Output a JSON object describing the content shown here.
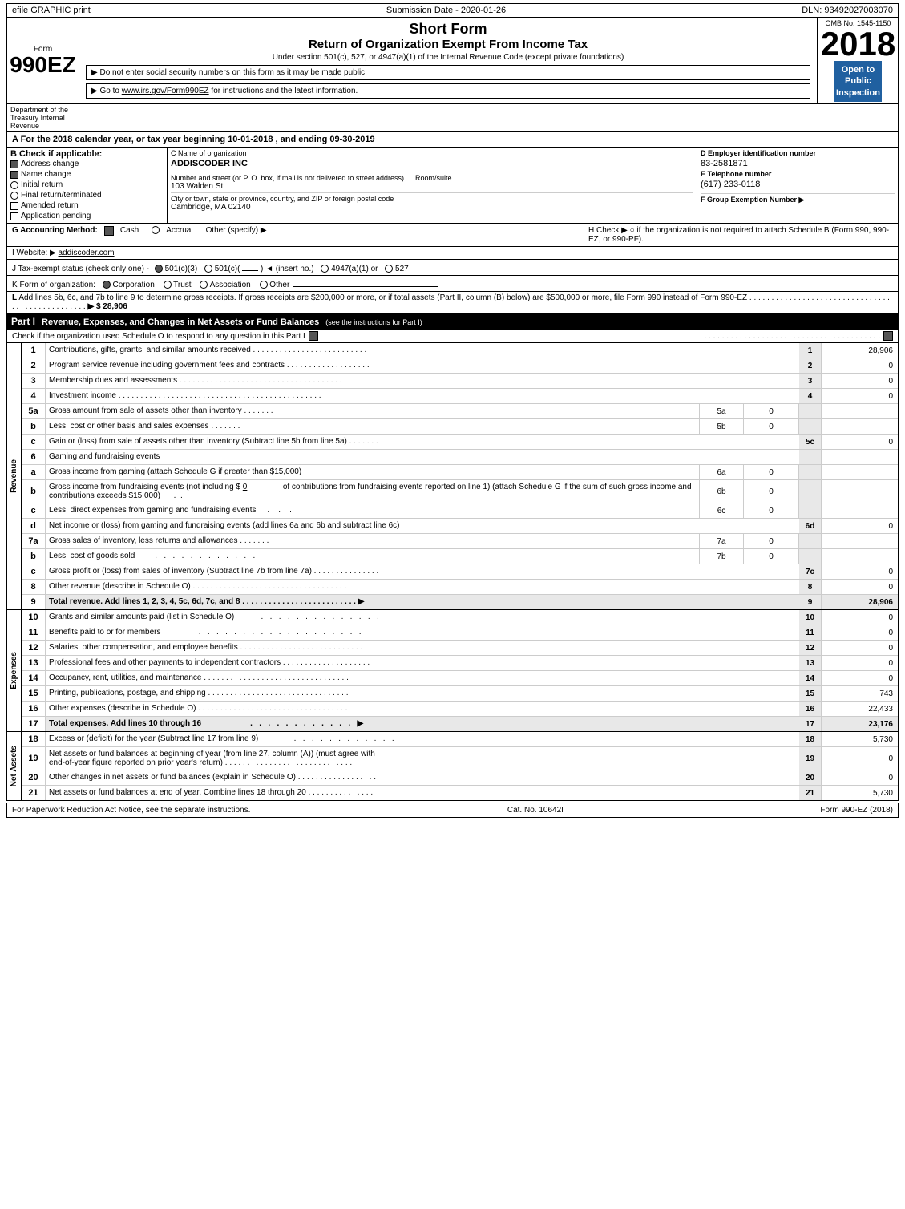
{
  "topbar": {
    "efile": "efile GRAPHIC print",
    "submission": "Submission Date - 2020-01-26",
    "dln": "DLN: 93492027003070"
  },
  "header": {
    "form_label": "Form",
    "form_number": "990EZ",
    "short_form": "Short Form",
    "return_title": "Return of Organization Exempt From Income Tax",
    "under_section": "Under section 501(c), 527, or 4947(a)(1) of the Internal Revenue Code (except private foundations)",
    "notice1": "▶ Do not enter social security numbers on this form as it may be made public.",
    "notice2": "▶ Go to www.irs.gov/Form990EZ for instructions and the latest information.",
    "omb_no": "OMB No. 1545-1150",
    "year": "2018",
    "open_to_public": "Open to\nPublic\nInspection"
  },
  "dept": {
    "name": "Department of the Treasury Internal Revenue"
  },
  "section_a": {
    "text": "A For the 2018 calendar year, or tax year beginning 10-01-2018         , and ending 09-30-2019"
  },
  "section_b": {
    "label": "B  Check if applicable:",
    "address_change": "Address change",
    "name_change": "Name change",
    "initial_return": "Initial return",
    "final_return": "Final return/terminated",
    "amended_return": "Amended return",
    "application_pending": "Application pending"
  },
  "org": {
    "c_label": "C Name of organization",
    "name": "ADDISCODER INC",
    "address_label": "Number and street (or P. O. box, if mail is not delivered to street address)",
    "address": "103 Walden St",
    "room_label": "Room/suite",
    "city_label": "City or town, state or province, country, and ZIP or foreign postal code",
    "city": "Cambridge, MA  02140",
    "d_label": "D Employer identification number",
    "ein": "83-2581871",
    "e_label": "E Telephone number",
    "phone": "(617) 233-0118",
    "f_label": "F Group Exemption Number",
    "f_arrow": "▶"
  },
  "accounting": {
    "g_label": "G Accounting Method:",
    "cash_checked": true,
    "cash_label": "Cash",
    "accrual_label": "Accrual",
    "other_label": "Other (specify) ▶",
    "h_label": "H  Check ▶",
    "h_text": "○ if the organization is not required to attach Schedule B (Form 990, 990-EZ, or 990-PF)."
  },
  "website": {
    "i_label": "I Website: ▶",
    "url": "addiscoder.com"
  },
  "tax_exempt": {
    "j_label": "J Tax-exempt status",
    "j_note": "(check only one) -",
    "status_501c3": "501(c)(3)",
    "status_501c": "501(c)(",
    "insert_no": ") ◄ (insert no.)",
    "status_4947": "4947(a)(1) or",
    "status_527": "527"
  },
  "form_org": {
    "k_label": "K Form of organization:",
    "corp": "Corporation",
    "trust": "Trust",
    "assoc": "Association",
    "other": "Other"
  },
  "l_line": {
    "text": "L Add lines 5b, 6c, and 7b to line 9 to determine gross receipts. If gross receipts are $200,000 or more, or if total assets (Part II, column (B) below) are $500,000 or more, file Form 990 instead of Form 990-EZ",
    "dots": ". . . . . . . . . . . . . . . . . . . . . . . . . . . . . . . . . . . . . . . . . . . . .",
    "amount": "▶ $ 28,906"
  },
  "part1": {
    "label": "Part I",
    "title": "Revenue, Expenses, and Changes in Net Assets or Fund Balances",
    "see_instructions": "(see the instructions for Part I)",
    "schedule_o_text": "Check if the organization used Schedule O to respond to any question in this Part I",
    "rows": [
      {
        "num": "1",
        "desc": "Contributions, gifts, grants, and similar amounts received",
        "dots": true,
        "linenum": "1",
        "amount": "28,906"
      },
      {
        "num": "2",
        "desc": "Program service revenue including government fees and contracts",
        "dots": true,
        "linenum": "2",
        "amount": "0"
      },
      {
        "num": "3",
        "desc": "Membership dues and assessments",
        "dots": true,
        "linenum": "3",
        "amount": "0"
      },
      {
        "num": "4",
        "desc": "Investment income",
        "dots": true,
        "linenum": "4",
        "amount": "0"
      },
      {
        "num": "5a",
        "desc": "Gross amount from sale of assets other than inventory",
        "dots5": true,
        "ref": "5a",
        "refval": "0",
        "linenum": "",
        "amount": ""
      },
      {
        "num": "5b",
        "desc": "Less: cost or other basis and sales expenses",
        "dots5": true,
        "ref": "5b",
        "refval": "0",
        "linenum": "",
        "amount": ""
      },
      {
        "num": "5c",
        "desc": "Gain or (loss) from sale of assets other than inventory (Subtract line 5b from line 5a)",
        "dots": true,
        "linenum": "5c",
        "amount": "0"
      },
      {
        "num": "6",
        "desc": "Gaming and fundraising events",
        "linenum": "",
        "amount": ""
      },
      {
        "num": "6a",
        "desc": "Gross income from gaming (attach Schedule G if greater than $15,000)",
        "ref": "6a",
        "refval": "0",
        "linenum": "",
        "amount": ""
      },
      {
        "num": "6b",
        "desc": "Gross income from fundraising events (not including $ 0 of contributions from fundraising events reported on line 1) (attach Schedule G if the sum of such gross income and contributions exceeds $15,000)",
        "ref": "6b",
        "refval": "0",
        "linenum": "",
        "amount": ""
      },
      {
        "num": "6c",
        "desc": "Less: direct expenses from gaming and fundraising events",
        "ref": "6c",
        "refval": "0",
        "linenum": "",
        "amount": ""
      },
      {
        "num": "6d",
        "desc": "Net income or (loss) from gaming and fundraising events (add lines 6a and 6b and subtract line 6c)",
        "dots": true,
        "linenum": "6d",
        "amount": "0"
      },
      {
        "num": "7a",
        "desc": "Gross sales of inventory, less returns and allowances",
        "dots": true,
        "ref": "7a",
        "refval": "0",
        "linenum": "",
        "amount": ""
      },
      {
        "num": "7b",
        "desc": "Less: cost of goods sold",
        "dots": true,
        "ref": "7b",
        "refval": "0",
        "linenum": "",
        "amount": ""
      },
      {
        "num": "7c",
        "desc": "Gross profit or (loss) from sales of inventory (Subtract line 7b from line 7a)",
        "dots": true,
        "linenum": "7c",
        "amount": "0"
      },
      {
        "num": "8",
        "desc": "Other revenue (describe in Schedule O)",
        "dots": true,
        "linenum": "8",
        "amount": "0"
      },
      {
        "num": "9",
        "desc": "Total revenue. Add lines 1, 2, 3, 4, 5c, 6d, 7c, and 8",
        "dots": true,
        "bold": true,
        "arrow": true,
        "linenum": "9",
        "amount": "28,906"
      }
    ],
    "expenses_rows": [
      {
        "num": "10",
        "desc": "Grants and similar amounts paid (list in Schedule O)",
        "dots": true,
        "linenum": "10",
        "amount": "0"
      },
      {
        "num": "11",
        "desc": "Benefits paid to or for members",
        "dots": true,
        "linenum": "11",
        "amount": "0"
      },
      {
        "num": "12",
        "desc": "Salaries, other compensation, and employee benefits",
        "dots": true,
        "linenum": "12",
        "amount": "0"
      },
      {
        "num": "13",
        "desc": "Professional fees and other payments to independent contractors",
        "dots": true,
        "linenum": "13",
        "amount": "0"
      },
      {
        "num": "14",
        "desc": "Occupancy, rent, utilities, and maintenance",
        "dots": true,
        "linenum": "14",
        "amount": "0"
      },
      {
        "num": "15",
        "desc": "Printing, publications, postage, and shipping",
        "dots": true,
        "linenum": "15",
        "amount": "743"
      },
      {
        "num": "16",
        "desc": "Other expenses (describe in Schedule O)",
        "dots": true,
        "linenum": "16",
        "amount": "22,433"
      },
      {
        "num": "17",
        "desc": "Total expenses. Add lines 10 through 16",
        "dots": true,
        "bold": true,
        "arrow": true,
        "linenum": "17",
        "amount": "23,176"
      }
    ],
    "net_assets_rows": [
      {
        "num": "18",
        "desc": "Excess or (deficit) for the year (Subtract line 17 from line 9)",
        "dots": true,
        "linenum": "18",
        "amount": "5,730"
      },
      {
        "num": "19",
        "desc": "Net assets or fund balances at beginning of year (from line 27, column (A)) (must agree with end-of-year figure reported on prior year's return)",
        "dots": true,
        "linenum": "19",
        "amount": "0"
      },
      {
        "num": "20",
        "desc": "Other changes in net assets or fund balances (explain in Schedule O)",
        "dots": true,
        "linenum": "20",
        "amount": "0"
      },
      {
        "num": "21",
        "desc": "Net assets or fund balances at end of year. Combine lines 18 through 20",
        "dots": true,
        "linenum": "21",
        "amount": "5,730"
      }
    ]
  },
  "footer": {
    "paperwork": "For Paperwork Reduction Act Notice, see the separate instructions.",
    "cat_no": "Cat. No. 10642I",
    "form_ref": "Form 990-EZ (2018)"
  }
}
